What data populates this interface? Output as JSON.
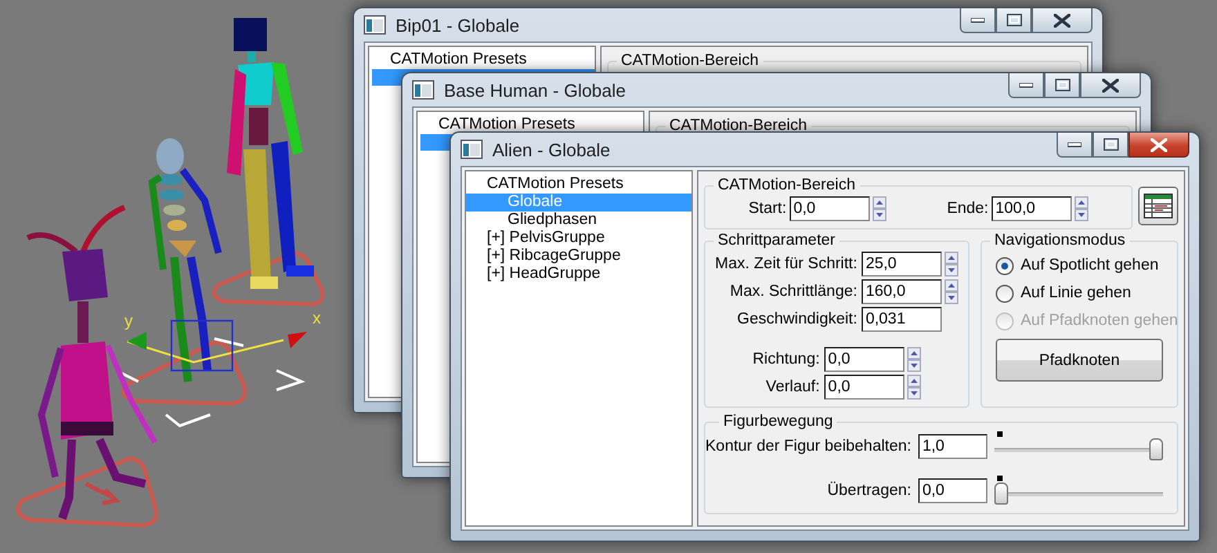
{
  "viewport": {
    "axis_labels": [
      "y",
      "x"
    ]
  },
  "windows": [
    {
      "title": "Bip01 - Globale",
      "active": false,
      "tree": [
        {
          "label": "CATMotion Presets",
          "selected": false
        }
      ],
      "section_title": "CATMotion-Bereich"
    },
    {
      "title": "Base Human - Globale",
      "active": false,
      "tree": [
        {
          "label": "CATMotion Presets",
          "selected": false
        }
      ],
      "section_title": "CATMotion-Bereich"
    },
    {
      "title": "Alien - Globale",
      "active": true,
      "tree": [
        {
          "label": "CATMotion Presets",
          "selected": false,
          "children": [
            {
              "label": "Globale",
              "selected": true
            },
            {
              "label": "Gliedphasen",
              "selected": false
            }
          ]
        },
        {
          "label": "[+] PelvisGruppe",
          "selected": false
        },
        {
          "label": "[+] RibcageGruppe",
          "selected": false
        },
        {
          "label": "[+] HeadGruppe",
          "selected": false
        }
      ],
      "panel": {
        "range": {
          "title": "CATMotion-Bereich",
          "fields": [
            {
              "label": "Start:",
              "value": "0,0"
            },
            {
              "label": "Ende:",
              "value": "100,0"
            }
          ]
        },
        "step": {
          "title": "Schrittparameter",
          "field_groups": [
            [
              {
                "label": "Max. Zeit für Schritt:",
                "value": "25,0",
                "spinner": true
              },
              {
                "label": "Max. Schrittlänge:",
                "value": "160,0",
                "spinner": true
              },
              {
                "label": "Geschwindigkeit:",
                "value": "0,031",
                "spinner": false
              }
            ],
            [
              {
                "label": "Richtung:",
                "value": "0,0",
                "spinner": true
              },
              {
                "label": "Verlauf:",
                "value": "0,0",
                "spinner": true
              }
            ]
          ]
        },
        "navigation": {
          "title": "Navigationsmodus",
          "options": [
            {
              "label": "Auf Spotlicht gehen",
              "selected": true,
              "disabled": false
            },
            {
              "label": "Auf Linie gehen",
              "selected": false,
              "disabled": false
            },
            {
              "label": "Auf Pfadknoten gehen",
              "selected": false,
              "disabled": true
            }
          ],
          "button": "Pfadknoten"
        },
        "motion": {
          "title": "Figurbewegung",
          "sliders": [
            {
              "label": "Kontur der Figur beibehalten:",
              "value": "1,0",
              "level": 1
            },
            {
              "label": "Übertragen:",
              "value": "0,0",
              "level": 0
            }
          ]
        }
      }
    }
  ]
}
